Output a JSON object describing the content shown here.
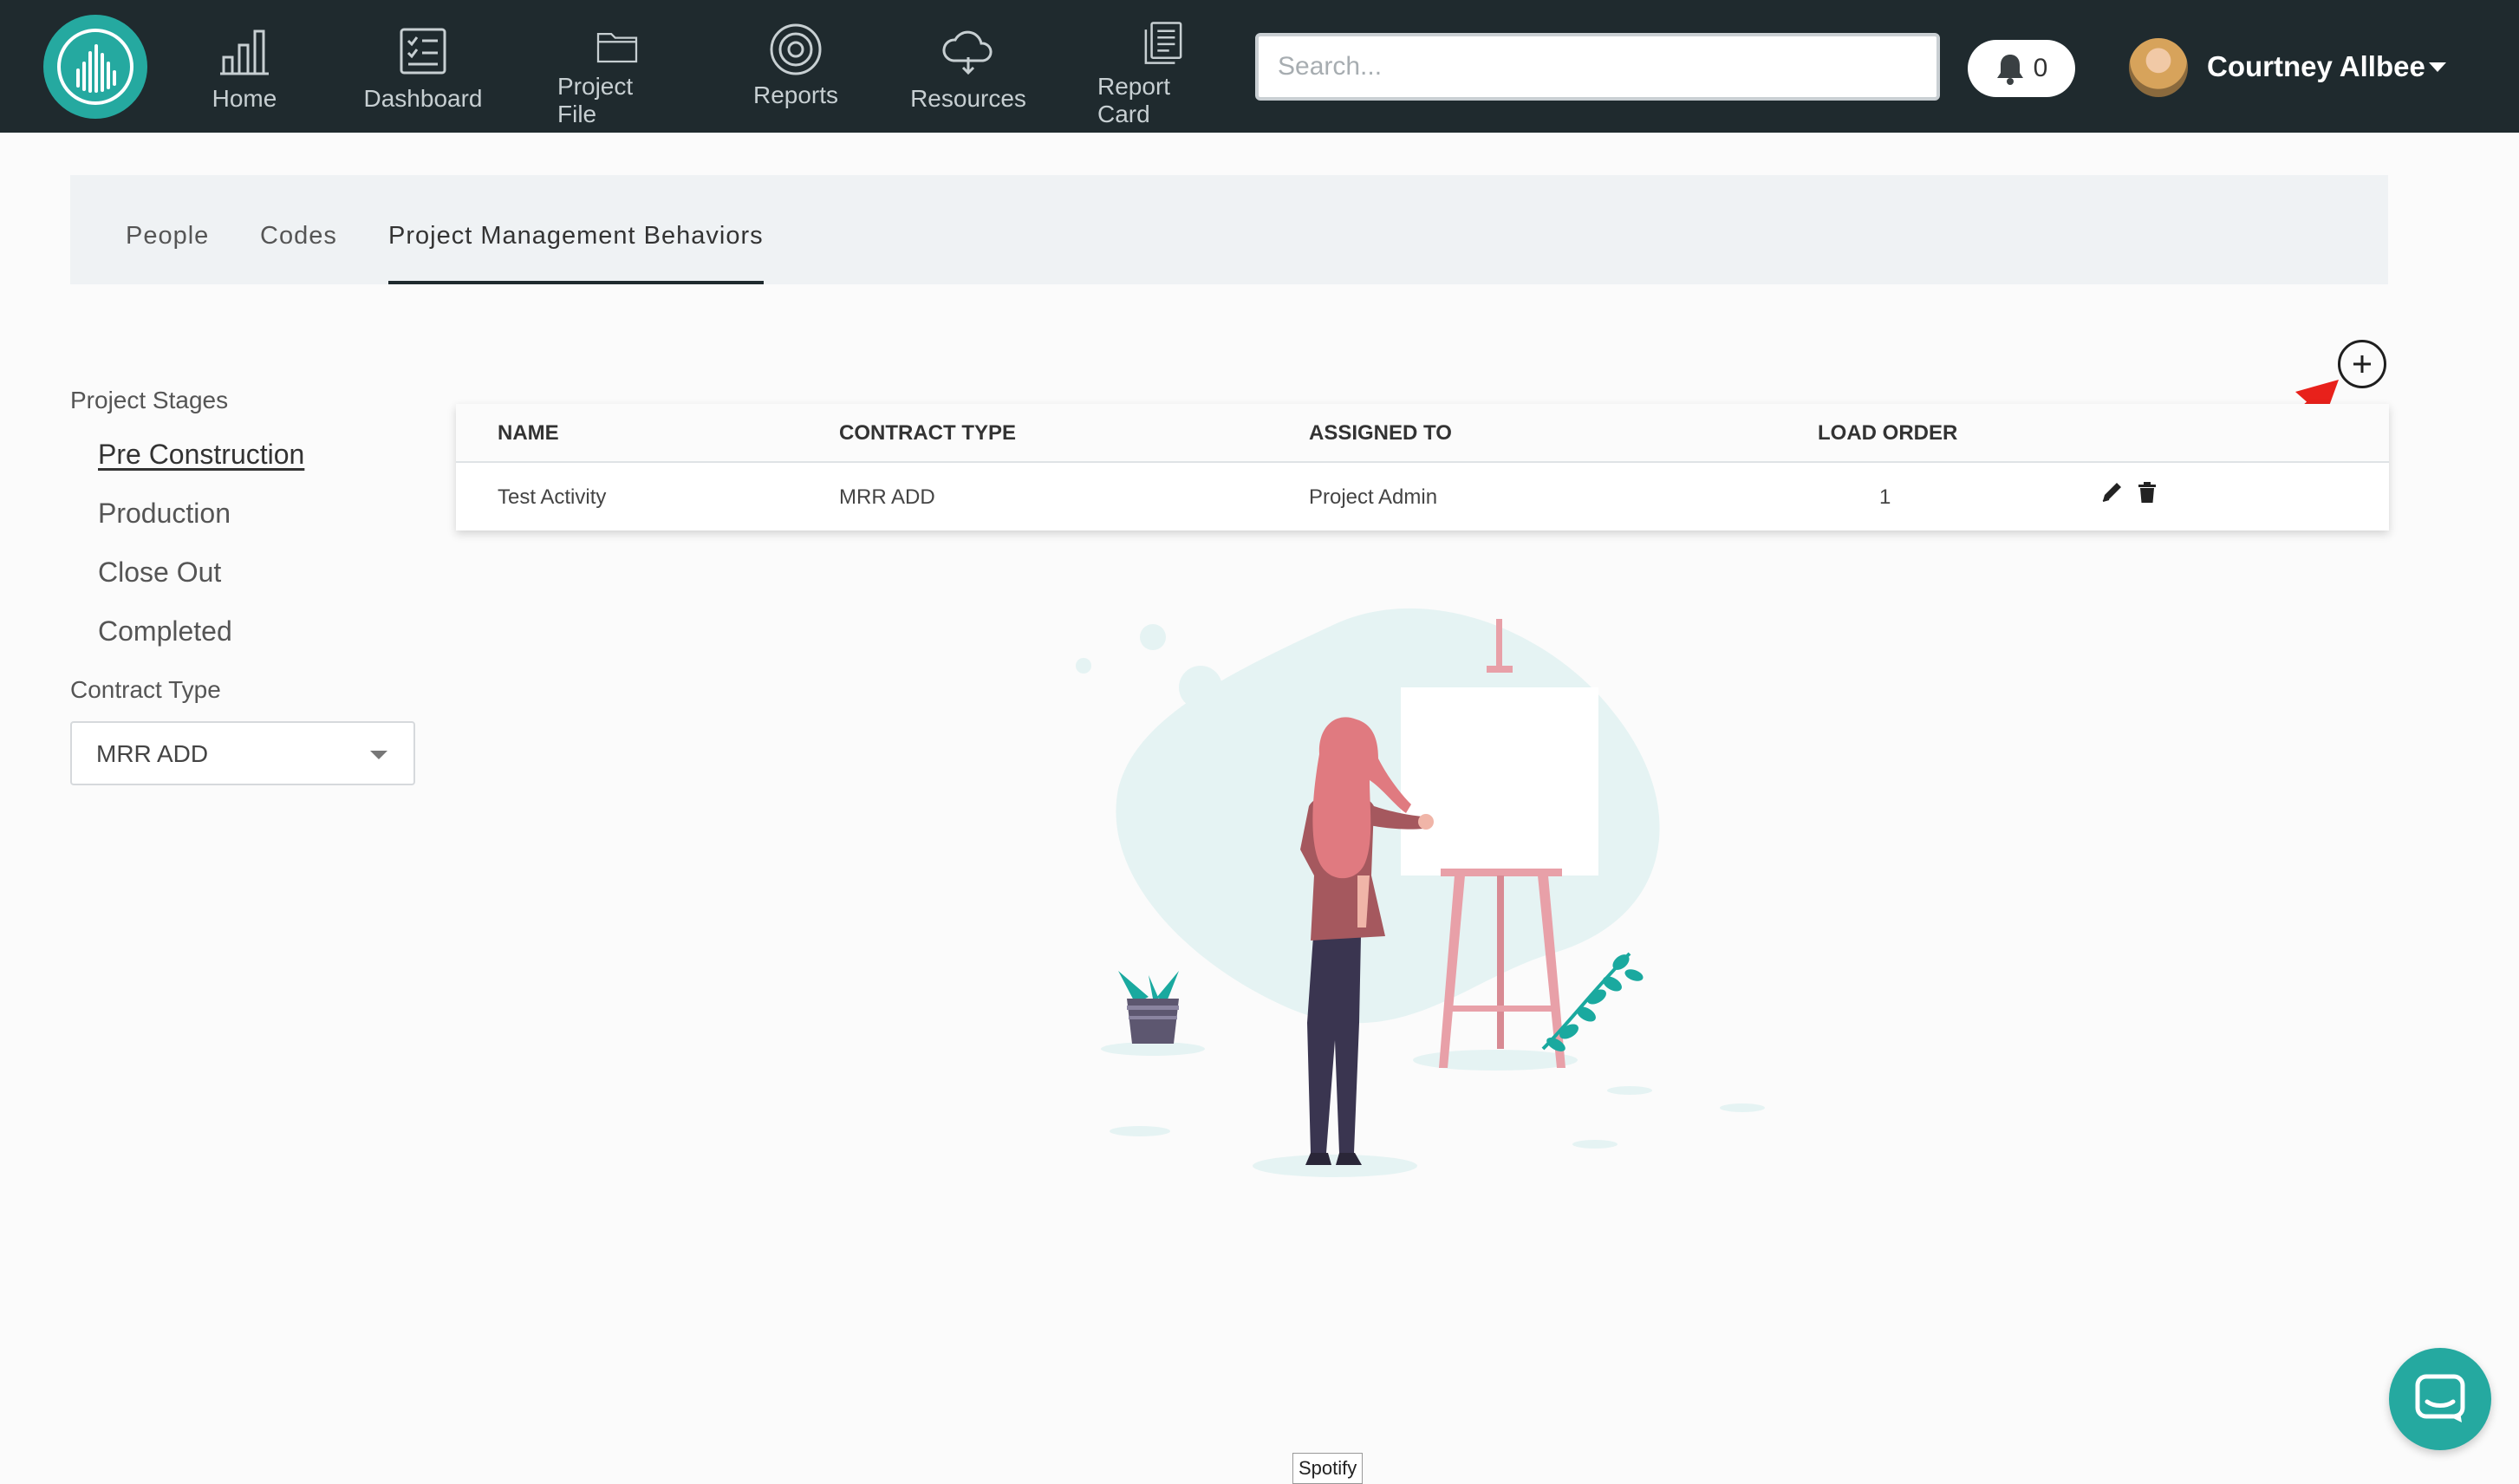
{
  "nav": {
    "items": [
      {
        "label": "Home",
        "icon": "bar-chart-icon"
      },
      {
        "label": "Dashboard",
        "icon": "checklist-icon"
      },
      {
        "label": "Project File",
        "icon": "folder-icon"
      },
      {
        "label": "Reports",
        "icon": "target-icon"
      },
      {
        "label": "Resources",
        "icon": "cloud-icon"
      },
      {
        "label": "Report Card",
        "icon": "document-icon"
      }
    ],
    "search_placeholder": "Search...",
    "notifications_count": "0",
    "user_name": "Courtney Allbee"
  },
  "tabs": [
    {
      "label": "People"
    },
    {
      "label": "Codes"
    },
    {
      "label": "Project Management Behaviors",
      "active": true
    }
  ],
  "sidebar": {
    "stages_heading": "Project Stages",
    "stages": [
      {
        "label": "Pre Construction",
        "active": true
      },
      {
        "label": "Production"
      },
      {
        "label": "Close Out"
      },
      {
        "label": "Completed"
      }
    ],
    "contract_type_heading": "Contract Type",
    "contract_type_value": "MRR ADD"
  },
  "table": {
    "columns": [
      "NAME",
      "CONTRACT TYPE",
      "ASSIGNED TO",
      "LOAD ORDER"
    ],
    "rows": [
      {
        "name": "Test Activity",
        "contract_type": "MRR ADD",
        "assigned_to": "Project Admin",
        "load_order": "1"
      }
    ]
  },
  "tooltip_text": "Spotify",
  "colors": {
    "topbar": "#1f2a2e",
    "accent": "#25a9a0",
    "annotation_arrow": "#e8211b"
  }
}
